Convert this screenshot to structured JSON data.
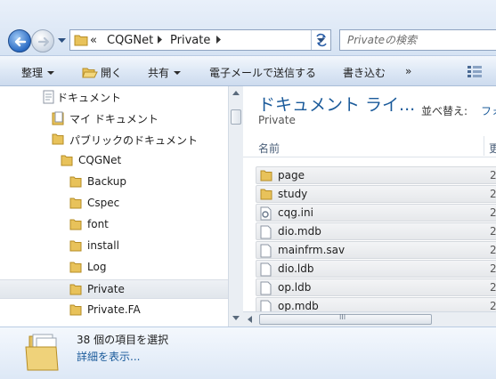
{
  "address": {
    "overflow": "«",
    "crumbs": [
      "CQGNet",
      "Private"
    ]
  },
  "search": {
    "placeholder": "Privateの検索"
  },
  "toolbar": {
    "organize": "整理",
    "open": "開く",
    "share": "共有",
    "email": "電子メールで送信する",
    "burn": "書き込む",
    "more": "»"
  },
  "nav": {
    "items": [
      {
        "label": "ドキュメント",
        "icon": "documents-library-icon"
      },
      {
        "label": "マイ ドキュメント",
        "icon": "documents-folder-icon"
      },
      {
        "label": "パブリックのドキュメント",
        "icon": "folder-icon"
      },
      {
        "label": "CQGNet",
        "icon": "folder-icon"
      },
      {
        "label": "Backup",
        "icon": "folder-icon"
      },
      {
        "label": "Cspec",
        "icon": "folder-icon"
      },
      {
        "label": "font",
        "icon": "folder-icon"
      },
      {
        "label": "install",
        "icon": "folder-icon"
      },
      {
        "label": "Log",
        "icon": "folder-icon"
      },
      {
        "label": "Private",
        "icon": "folder-icon",
        "selected": true
      },
      {
        "label": "Private.FA",
        "icon": "folder-icon"
      }
    ]
  },
  "content": {
    "library_title": "ドキュメント ライ...",
    "library_subtitle": "Private",
    "sort_label": "並べ替え:",
    "sort_value": "フォ",
    "col_name": "名前",
    "col_date": "更",
    "files": [
      {
        "name": "page",
        "type": "folder",
        "date": "2"
      },
      {
        "name": "study",
        "type": "folder",
        "date": "2"
      },
      {
        "name": "cqg.ini",
        "type": "ini",
        "date": "2"
      },
      {
        "name": "dio.mdb",
        "type": "file",
        "date": "2"
      },
      {
        "name": "mainfrm.sav",
        "type": "file",
        "date": "2"
      },
      {
        "name": "dio.ldb",
        "type": "file",
        "date": "2"
      },
      {
        "name": "op.ldb",
        "type": "file",
        "date": "2"
      },
      {
        "name": "op.mdb",
        "type": "file",
        "date": "2"
      }
    ]
  },
  "hscroll": {
    "grip": "III"
  },
  "details": {
    "count": "38 個の項目を選択",
    "show_details": "詳細を表示..."
  }
}
